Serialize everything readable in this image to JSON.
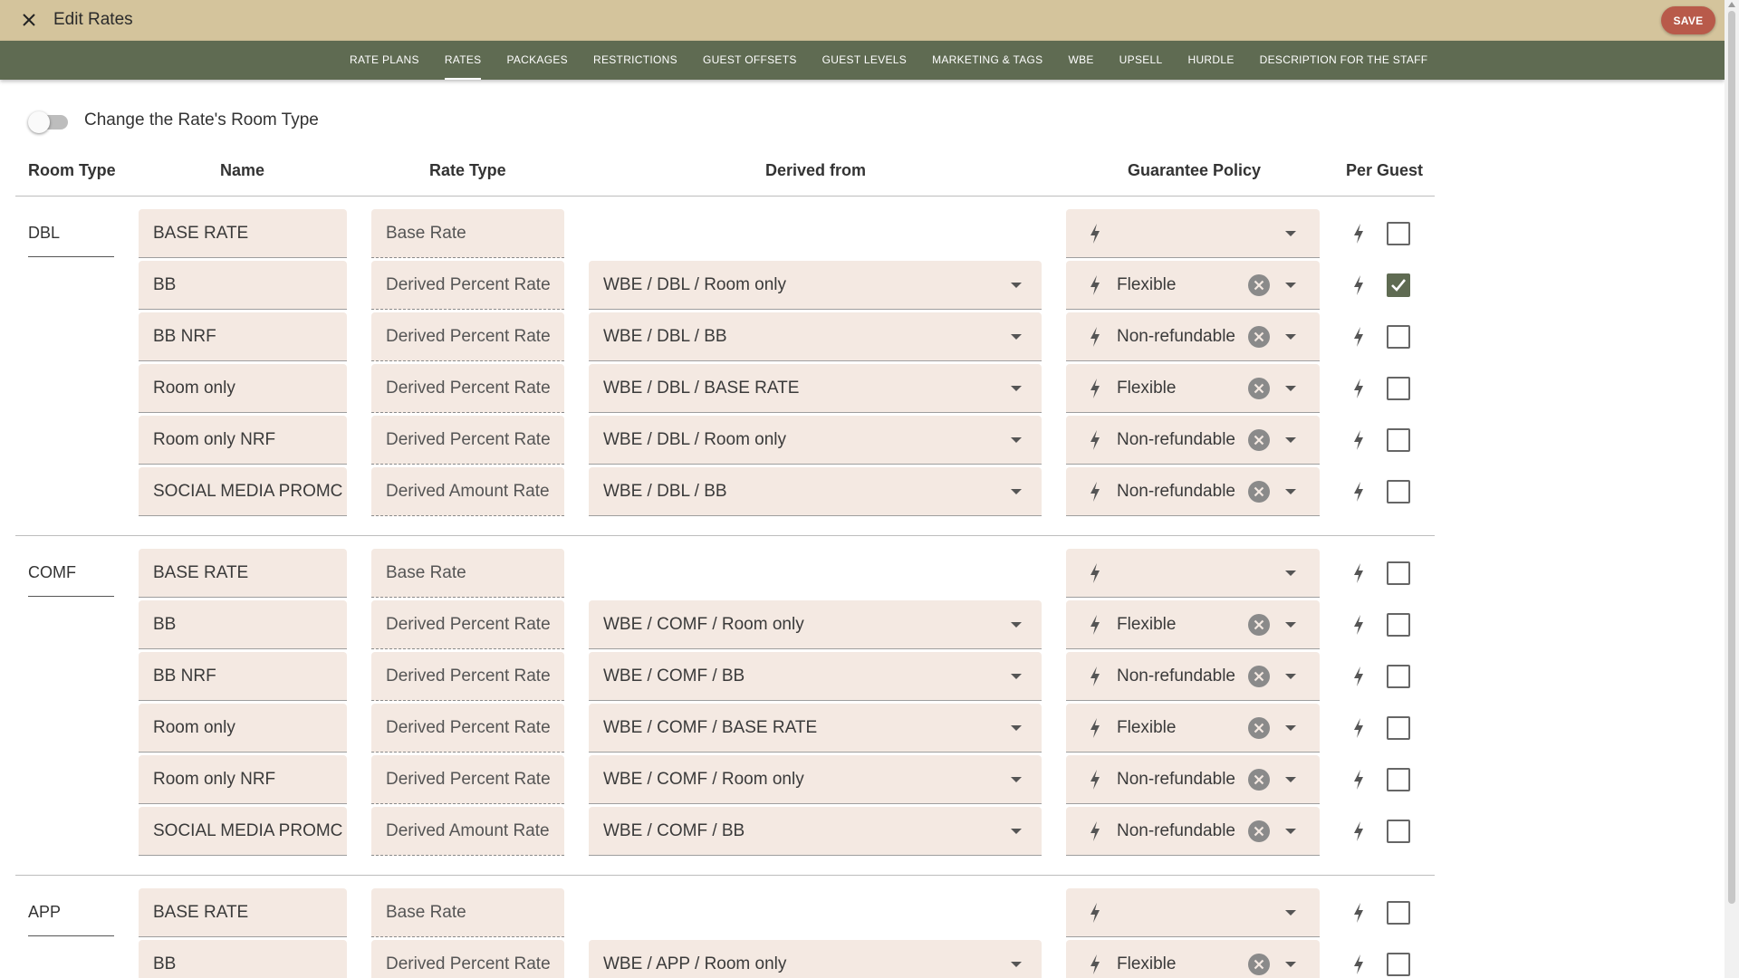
{
  "window": {
    "title": "Edit Rates",
    "save_label": "SAVE"
  },
  "tabs": [
    {
      "label": "RATE PLANS",
      "active": false
    },
    {
      "label": "RATES",
      "active": true
    },
    {
      "label": "PACKAGES",
      "active": false
    },
    {
      "label": "RESTRICTIONS",
      "active": false
    },
    {
      "label": "GUEST OFFSETS",
      "active": false
    },
    {
      "label": "GUEST LEVELS",
      "active": false
    },
    {
      "label": "MARKETING & TAGS",
      "active": false
    },
    {
      "label": "WBE",
      "active": false
    },
    {
      "label": "UPSELL",
      "active": false
    },
    {
      "label": "HURDLE",
      "active": false
    },
    {
      "label": "DESCRIPTION FOR THE STAFF",
      "active": false
    }
  ],
  "toggle": {
    "label": "Change the Rate's Room Type",
    "on": false
  },
  "columns": {
    "room_type": "Room Type",
    "name": "Name",
    "rate_type": "Rate Type",
    "derived_from": "Derived from",
    "guarantee_policy": "Guarantee Policy",
    "per_guest": "Per Guest"
  },
  "groups": [
    {
      "room_type": "DBL",
      "rows": [
        {
          "name": "BASE RATE",
          "rate_type": "Base Rate",
          "derived_from": "",
          "guarantee": "",
          "per_guest": false
        },
        {
          "name": "BB",
          "rate_type": "Derived Percent Rate",
          "derived_from": "WBE / DBL / Room only",
          "guarantee": "Flexible",
          "per_guest": true
        },
        {
          "name": "BB NRF",
          "rate_type": "Derived Percent Rate",
          "derived_from": "WBE / DBL / BB",
          "guarantee": "Non-refundable",
          "per_guest": false
        },
        {
          "name": "Room only",
          "rate_type": "Derived Percent Rate",
          "derived_from": "WBE / DBL / BASE RATE",
          "guarantee": "Flexible",
          "per_guest": false
        },
        {
          "name": "Room only NRF",
          "rate_type": "Derived Percent Rate",
          "derived_from": "WBE / DBL / Room only",
          "guarantee": "Non-refundable",
          "per_guest": false
        },
        {
          "name": "SOCIAL MEDIA PROMC",
          "rate_type": "Derived Amount Rate",
          "derived_from": "WBE / DBL / BB",
          "guarantee": "Non-refundable",
          "per_guest": false
        }
      ]
    },
    {
      "room_type": "COMF",
      "rows": [
        {
          "name": "BASE RATE",
          "rate_type": "Base Rate",
          "derived_from": "",
          "guarantee": "",
          "per_guest": false
        },
        {
          "name": "BB",
          "rate_type": "Derived Percent Rate",
          "derived_from": "WBE / COMF / Room only",
          "guarantee": "Flexible",
          "per_guest": false
        },
        {
          "name": "BB NRF",
          "rate_type": "Derived Percent Rate",
          "derived_from": "WBE / COMF / BB",
          "guarantee": "Non-refundable",
          "per_guest": false
        },
        {
          "name": "Room only",
          "rate_type": "Derived Percent Rate",
          "derived_from": "WBE / COMF / BASE RATE",
          "guarantee": "Flexible",
          "per_guest": false
        },
        {
          "name": "Room only NRF",
          "rate_type": "Derived Percent Rate",
          "derived_from": "WBE / COMF / Room only",
          "guarantee": "Non-refundable",
          "per_guest": false
        },
        {
          "name": "SOCIAL MEDIA PROMC",
          "rate_type": "Derived Amount Rate",
          "derived_from": "WBE / COMF / BB",
          "guarantee": "Non-refundable",
          "per_guest": false
        }
      ]
    },
    {
      "room_type": "APP",
      "rows": [
        {
          "name": "BASE RATE",
          "rate_type": "Base Rate",
          "derived_from": "",
          "guarantee": "",
          "per_guest": false
        },
        {
          "name": "BB",
          "rate_type": "Derived Percent Rate",
          "derived_from": "WBE / APP / Room only",
          "guarantee": "Flexible",
          "per_guest": false
        }
      ]
    }
  ],
  "colors": {
    "titlebar": "#d4c49c",
    "tabbar": "#5f6b52",
    "save": "#b85a4a",
    "field": "#f4e9e2"
  }
}
